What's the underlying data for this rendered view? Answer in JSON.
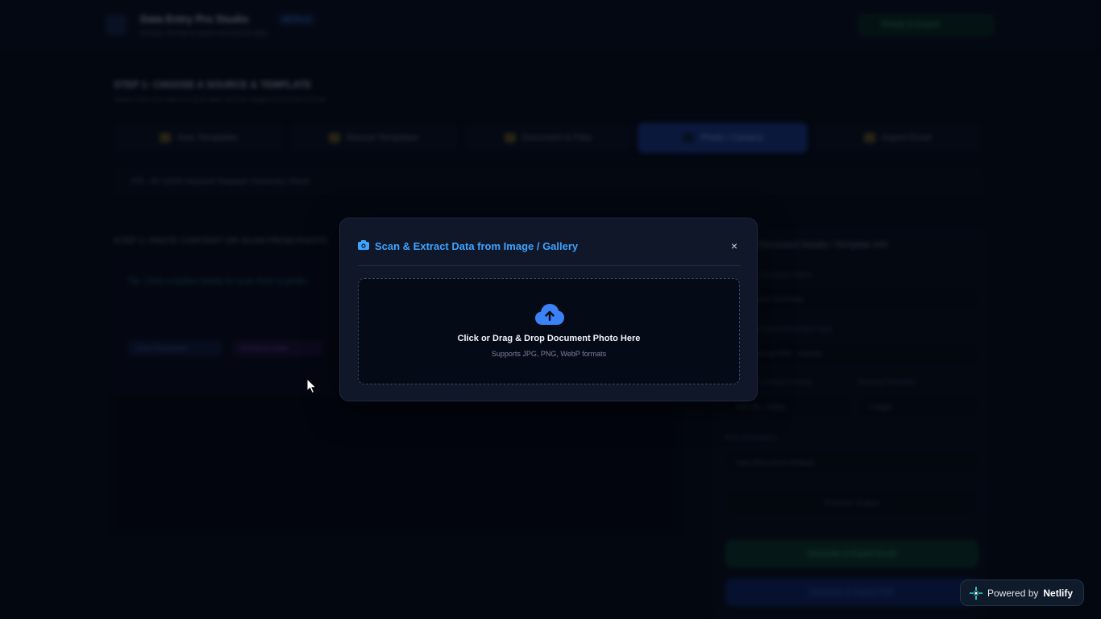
{
  "app": {
    "title": "Data Entry Pro Studio",
    "subtitle": "Extract, format & export structured data",
    "badge": "BETA v2",
    "status": "Ready to Export"
  },
  "step1": {
    "title": "STEP 1: CHOOSE A SOURCE & TEMPLATE",
    "subtitle": "Select how you want to input data and the target document format"
  },
  "tabs": [
    {
      "label": "Auto Templates",
      "active": false
    },
    {
      "label": "Manual Templates",
      "active": false
    },
    {
      "label": "Document & Files",
      "active": false
    },
    {
      "label": "Photo / Camera",
      "active": true
    },
    {
      "label": "Import Excel",
      "active": false
    }
  ],
  "template_select": {
    "value": "ITR - AY 24/25 Salaried Taxpayer Summary Sheet"
  },
  "step2": {
    "title": "STEP 2: PASTE CONTENT OR SCAN FROM PHOTO",
    "hint": "Tip: Click a button below to scan from a photo",
    "chips": [
      "Scan Document",
      "Fill Demo Data"
    ]
  },
  "right_panel": {
    "title": "Document Details / Template Info",
    "fields": [
      {
        "label": "Document Name",
        "value": "Tax Return Summary"
      },
      {
        "label": "Output Document Type",
        "value": "Standard A4 PDF - Portrait"
      },
      {
        "label": "Currency Format",
        "value": "INR (₹) - Indian"
      },
      {
        "label": "Decimal Precision",
        "value": "2 Digits"
      },
      {
        "label": "Row Orientation",
        "value": "Auto (Document default)"
      }
    ],
    "preview_button": "Preview Output",
    "excel_button": "Generate & Export Excel",
    "pdf_button": "Generate & Export PDF"
  },
  "modal": {
    "title": "Scan & Extract Data from Image / Gallery",
    "close_label": "×",
    "drop_title": "Click or Drag & Drop Document Photo Here",
    "drop_sub": "Supports JPG, PNG, WebP formats"
  },
  "netlify": {
    "prefix": "Powered by",
    "brand": "Netlify"
  },
  "colors": {
    "accent": "#3fa3ff",
    "upload_icon": "#3b82f6",
    "background": "#040813",
    "modal_bg": "#0f1729",
    "netlify_teal": "#32e6e2"
  }
}
